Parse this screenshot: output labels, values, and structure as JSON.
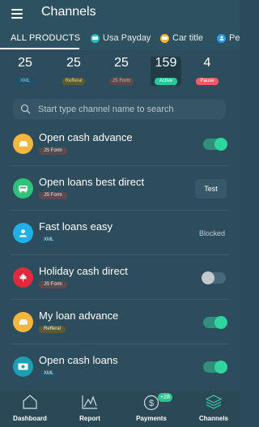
{
  "header": {
    "title": "Channels"
  },
  "tabs": [
    {
      "label": "ALL PRODUCTS"
    },
    {
      "label": "Usa Payday",
      "icon": "car-icon",
      "color": "#2fb7c7"
    },
    {
      "label": "Car title",
      "icon": "car-icon",
      "color": "#f2b23b"
    },
    {
      "label": "Pe",
      "icon": "person-icon",
      "color": "#2d9be8"
    }
  ],
  "stats": [
    {
      "value": "25",
      "label": "XML",
      "bg": "#1f4f69",
      "fg": "#8fd0ef"
    },
    {
      "value": "25",
      "label": "Refferal",
      "bg": "#5a5a34",
      "fg": "#e0d58a"
    },
    {
      "value": "25",
      "label": "JS Form",
      "bg": "#5a4a4a",
      "fg": "#d9b6b6"
    },
    {
      "value": "159",
      "label": "Active",
      "bg": "#27c99a",
      "fg": "#ffffff"
    },
    {
      "value": "4",
      "label": "Pause",
      "bg": "#ef5b64",
      "fg": "#ffffff"
    }
  ],
  "search": {
    "placeholder": "Start type channel name to search"
  },
  "channels": [
    {
      "name": "Open cash advance",
      "badge": "JS Form",
      "badge_bg": "#5c4a4e",
      "avatar_color": "#f4b63c",
      "icon": "car-icon",
      "state": "on"
    },
    {
      "name": "Open loans best direct",
      "badge": "JS Form",
      "badge_bg": "#5c4a4e",
      "avatar_color": "#2ec27a",
      "icon": "bus-icon",
      "state": "test"
    },
    {
      "name": "Fast loans easy",
      "badge": "XML",
      "badge_bg": "#245068",
      "avatar_color": "#1fb0e8",
      "icon": "person-icon",
      "state": "blocked"
    },
    {
      "name": "Holiday cash direct",
      "badge": "JS Form",
      "badge_bg": "#5c4a4e",
      "avatar_color": "#e0293b",
      "icon": "maple-leaf-icon",
      "state": "off"
    },
    {
      "name": "My loan advance",
      "badge": "Refferal",
      "badge_bg": "#5c5a36",
      "avatar_color": "#f4b63c",
      "icon": "car-icon",
      "state": "on"
    },
    {
      "name": "Open cash loans",
      "badge": "XML",
      "badge_bg": "#245068",
      "avatar_color": "#1a9fb5",
      "icon": "money-icon",
      "state": "on"
    }
  ],
  "actions": {
    "test_label": "Test",
    "blocked_label": "Blocked"
  },
  "nav": [
    {
      "label": "Dashboard",
      "icon": "home-icon"
    },
    {
      "label": "Report",
      "icon": "chart-line-icon"
    },
    {
      "label": "Payments",
      "icon": "dollar-icon",
      "badge": "+28"
    },
    {
      "label": "Channels",
      "icon": "layers-icon",
      "active": true
    }
  ],
  "colors": {
    "accent": "#2fd49e",
    "background": "#2d4c5c",
    "header": "#2e5160"
  }
}
